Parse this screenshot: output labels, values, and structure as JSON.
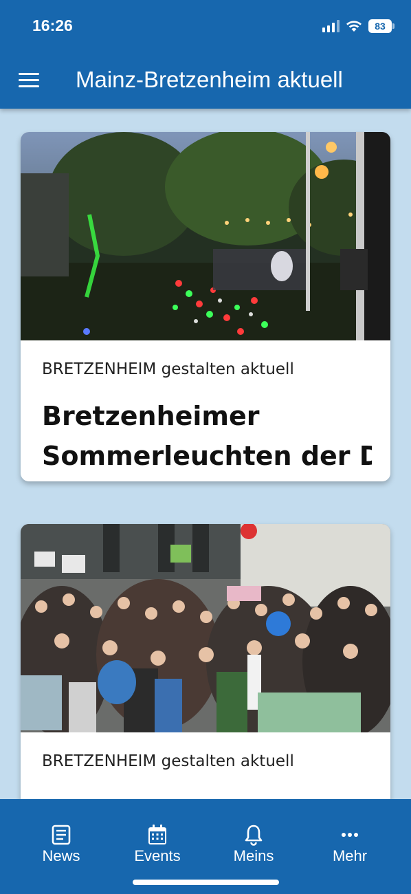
{
  "status_bar": {
    "time": "16:26",
    "battery": "83"
  },
  "app_bar": {
    "title": "Mainz-Bretzenheim aktuell",
    "menu_icon": "hamburger-menu-icon"
  },
  "feed": {
    "cards": [
      {
        "image": "night garden party with colorful lights",
        "source": "BRETZENHEIM gestalten aktuell",
        "title_line1": "Bretzenheimer",
        "title_line2": "Sommerleuchten der D…"
      },
      {
        "image": "crowd of children at a demonstration",
        "source": "BRETZENHEIM gestalten aktuell"
      }
    ]
  },
  "bottom_nav": {
    "items": [
      {
        "label": "News",
        "icon": "news-icon"
      },
      {
        "label": "Events",
        "icon": "calendar-icon"
      },
      {
        "label": "Meins",
        "icon": "bell-icon"
      },
      {
        "label": "Mehr",
        "icon": "more-dots-icon"
      }
    ]
  },
  "colors": {
    "primary": "#1767ae",
    "background": "#c3dcee",
    "card": "#ffffff"
  }
}
